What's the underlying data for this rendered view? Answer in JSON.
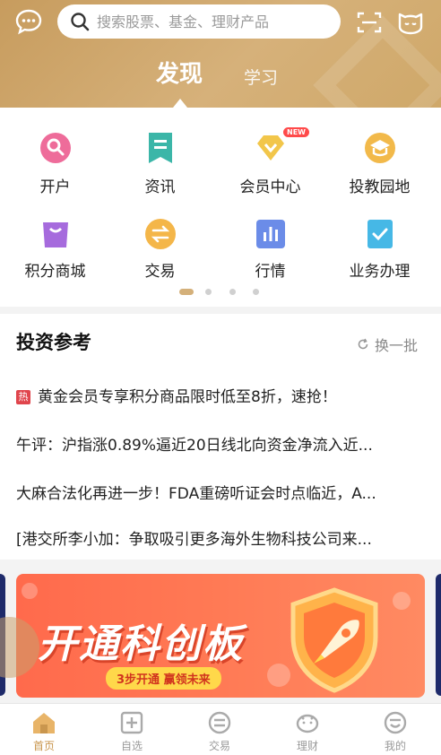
{
  "header": {
    "search_placeholder": "搜索股票、基金、理财产品",
    "icons": [
      "message-icon",
      "search-icon",
      "scan-icon",
      "cat-service-icon"
    ],
    "tabs": [
      {
        "label": "发现",
        "active": true
      },
      {
        "label": "学习",
        "active": false
      }
    ],
    "colors": {
      "header_gold": "#c79c5e",
      "accent": "#c9964e"
    }
  },
  "menu": {
    "items": [
      {
        "label": "开户",
        "icon": "key-icon"
      },
      {
        "label": "资讯",
        "icon": "news-bookmark-icon"
      },
      {
        "label": "会员中心",
        "icon": "diamond-icon",
        "badge": "NEW"
      },
      {
        "label": "投教园地",
        "icon": "graduation-cap-icon"
      },
      {
        "label": "积分商城",
        "icon": "shopping-bag-icon"
      },
      {
        "label": "交易",
        "icon": "exchange-icon"
      },
      {
        "label": "行情",
        "icon": "bar-chart-icon"
      },
      {
        "label": "业务办理",
        "icon": "check-clipboard-icon"
      }
    ],
    "page_count": 4,
    "current_page": 1
  },
  "news": {
    "title": "投资参考",
    "refresh_label": "换一批",
    "hot_tag": "热",
    "items": [
      "黄金会员专享积分商品限时低至8折，速抢！",
      "午评：沪指涨0.89%逼近20日线北向资金净流入近...",
      "大麻合法化再进一步！FDA重磅听证会时点临近，A...",
      "[港交所李小加：争取吸引更多海外生物科技公司来..."
    ]
  },
  "banner": {
    "headline": "开通科创板",
    "pill": "3步开通 赢领未来"
  },
  "bottom_nav": [
    {
      "label": "首页",
      "icon": "home-icon",
      "active": true
    },
    {
      "label": "自选",
      "icon": "add-square-icon",
      "active": false
    },
    {
      "label": "交易",
      "icon": "exchange-circle-icon",
      "active": false
    },
    {
      "label": "理财",
      "icon": "piggy-bank-icon",
      "active": false
    },
    {
      "label": "我的",
      "icon": "user-face-icon",
      "active": false
    }
  ]
}
